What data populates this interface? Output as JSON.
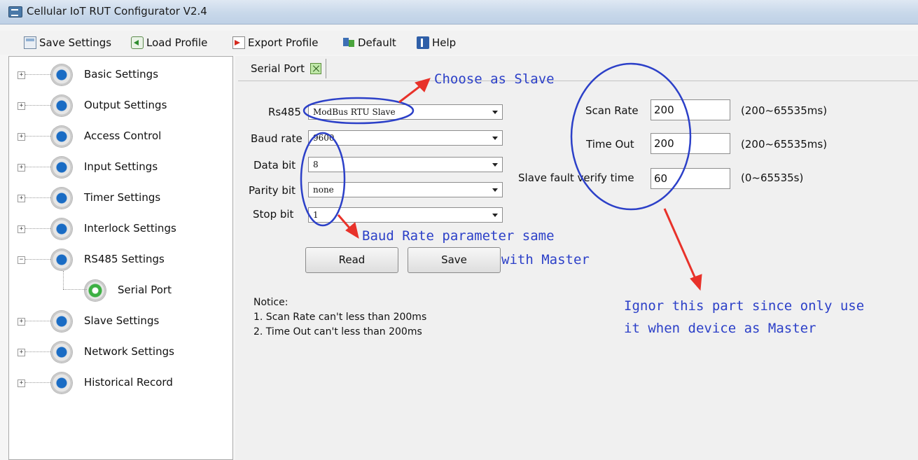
{
  "window": {
    "title": "Cellular IoT RUT Configurator V2.4"
  },
  "toolbar": {
    "save": "Save Settings",
    "load": "Load Profile",
    "export": "Export Profile",
    "default": "Default",
    "help": "Help"
  },
  "tree": {
    "items": [
      {
        "label": "Basic Settings",
        "expander": "+"
      },
      {
        "label": "Output Settings",
        "expander": "+"
      },
      {
        "label": "Access Control",
        "expander": "+"
      },
      {
        "label": "Input Settings",
        "expander": "+"
      },
      {
        "label": "Timer Settings",
        "expander": "+"
      },
      {
        "label": "Interlock Settings",
        "expander": "+"
      },
      {
        "label": "RS485 Settings",
        "expander": "−"
      },
      {
        "label": "Serial Port",
        "expander": ""
      },
      {
        "label": "Slave Settings",
        "expander": "+"
      },
      {
        "label": "Network Settings",
        "expander": "+"
      },
      {
        "label": "Historical Record",
        "expander": "+"
      }
    ]
  },
  "tab": {
    "label": "Serial Port"
  },
  "form": {
    "rs485": {
      "label": "Rs485",
      "value": "ModBus RTU Slave"
    },
    "baud": {
      "label": "Baud rate",
      "value": "9600"
    },
    "databit": {
      "label": "Data bit",
      "value": "8"
    },
    "parity": {
      "label": "Parity bit",
      "value": "none"
    },
    "stopbit": {
      "label": "Stop bit",
      "value": "1"
    },
    "scan_rate": {
      "label": "Scan Rate",
      "value": "200",
      "range": "(200~65535ms)"
    },
    "time_out": {
      "label": "Time Out",
      "value": "200",
      "range": "(200~65535ms)"
    },
    "slave_fault": {
      "label": "Slave fault verify time",
      "value": "60",
      "range": "(0~65535s)"
    },
    "read_button": "Read",
    "save_button": "Save"
  },
  "notice": {
    "title": "Notice:",
    "line1": "1. Scan Rate can't less than 200ms",
    "line2": "2. Time Out  can't less than 200ms"
  },
  "annotations": {
    "slave": "Choose as Slave",
    "baud_line1": "Baud Rate parameter same",
    "baud_line2": "with Master",
    "ignore_line1": "Ignor this part since only use",
    "ignore_line2": "it when device as Master",
    "color": "#2c40c8",
    "arrow_color": "#e8322a"
  }
}
